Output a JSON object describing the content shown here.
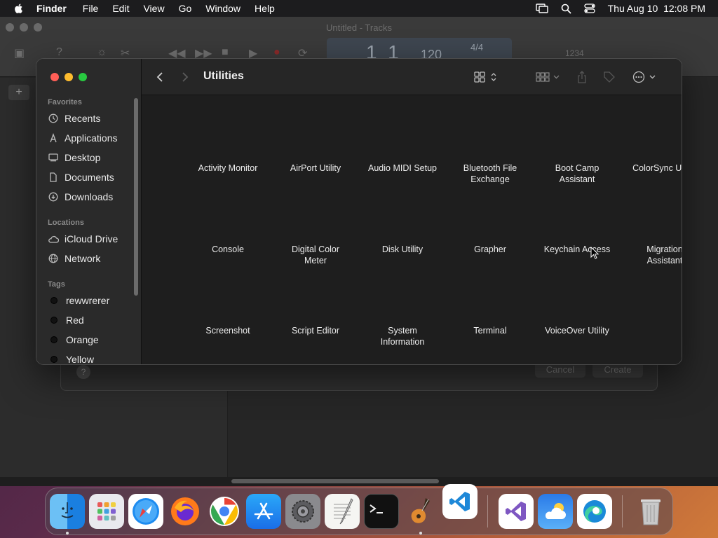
{
  "menubar": {
    "app_name": "Finder",
    "items": [
      "File",
      "Edit",
      "View",
      "Go",
      "Window",
      "Help"
    ],
    "datetime": "Thu Aug 10  12:08 PM"
  },
  "background_app": {
    "title": "Untitled - Tracks",
    "lcd_position": "1  1",
    "lcd_tempo": "120",
    "lcd_signature": "4/4",
    "counter": "1234"
  },
  "sheet": {
    "cancel_label": "Cancel",
    "create_label": "Create",
    "help_label": "?"
  },
  "finder": {
    "folder_title": "Utilities",
    "sidebar": {
      "favorites_header": "Favorites",
      "favorites": [
        {
          "label": "Recents",
          "icon": "clock-icon"
        },
        {
          "label": "Applications",
          "icon": "applications-icon"
        },
        {
          "label": "Desktop",
          "icon": "desktop-icon"
        },
        {
          "label": "Documents",
          "icon": "document-icon"
        },
        {
          "label": "Downloads",
          "icon": "download-icon"
        }
      ],
      "locations_header": "Locations",
      "locations": [
        {
          "label": "iCloud Drive",
          "icon": "cloud-icon"
        },
        {
          "label": "Network",
          "icon": "globe-icon"
        }
      ],
      "tags_header": "Tags",
      "tags": [
        {
          "label": "rewwrerer"
        },
        {
          "label": "Red"
        },
        {
          "label": "Orange"
        },
        {
          "label": "Yellow"
        }
      ]
    },
    "items": [
      [
        "Activity Monitor"
      ],
      [
        "AirPort Utility"
      ],
      [
        "Audio MIDI Setup"
      ],
      [
        "Bluetooth File",
        "Exchange"
      ],
      [
        "Boot Camp",
        "Assistant"
      ],
      [
        "ColorSync Utility"
      ],
      [
        "Console"
      ],
      [
        "Digital Color",
        "Meter"
      ],
      [
        "Disk Utility"
      ],
      [
        "Grapher"
      ],
      [
        "Keychain Access"
      ],
      [
        "Migration",
        "Assistant"
      ],
      [
        "Screenshot"
      ],
      [
        "Script Editor"
      ],
      [
        "System",
        "Information"
      ],
      [
        "Terminal"
      ],
      [
        "VoiceOver Utility"
      ]
    ]
  },
  "dock": {
    "apps": [
      "Finder",
      "Launchpad",
      "Safari",
      "Firefox",
      "Chrome",
      "App Store",
      "System Settings",
      "TextEdit",
      "Terminal",
      "GarageBand",
      "Visual Studio Code",
      "Visual Studio",
      "Weather",
      "Microsoft Edge",
      "Trash"
    ]
  }
}
